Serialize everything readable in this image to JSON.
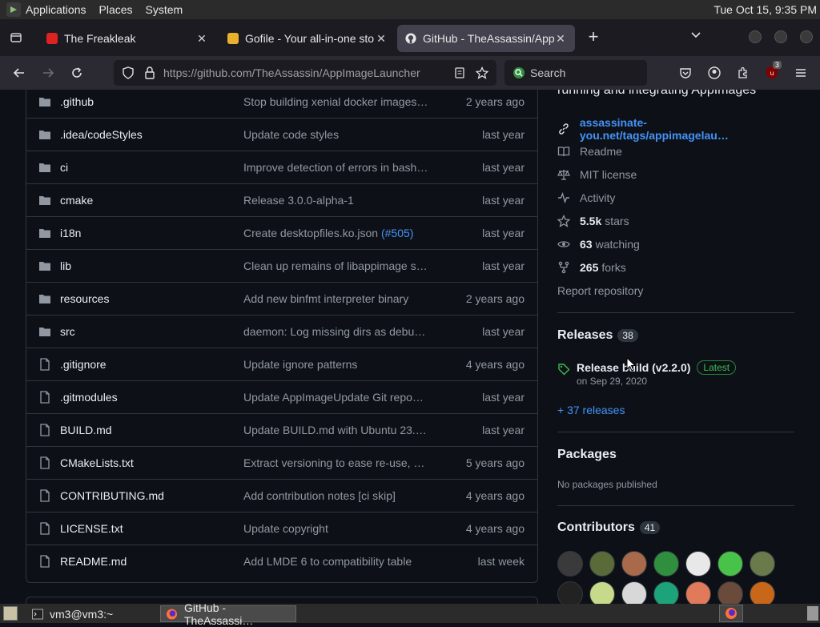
{
  "top_panel": {
    "menus": [
      "Applications",
      "Places",
      "System"
    ],
    "clock": "Tue Oct 15,  9:35 PM"
  },
  "tabs": [
    {
      "title": "The Freakleak",
      "close": "✕"
    },
    {
      "title": "Gofile - Your all-in-one storage",
      "close": "✕"
    },
    {
      "title": "GitHub - TheAssassin/AppImageLauncher",
      "close": "✕"
    }
  ],
  "toolbar": {
    "new_tab": "+",
    "url_host": "https://github.com",
    "url_path": "/TheAssassin/AppImageLauncher",
    "search_placeholder": "Search",
    "extension_badge": "3"
  },
  "files": [
    {
      "name": ".github",
      "type": "folder",
      "message": "Stop building xenial docker images…",
      "date": "2 years ago"
    },
    {
      "name": ".idea/codeStyles",
      "type": "folder",
      "message": "Update code styles",
      "date": "last year"
    },
    {
      "name": "ci",
      "type": "folder",
      "message": "Improve detection of errors in bash…",
      "date": "last year"
    },
    {
      "name": "cmake",
      "type": "folder",
      "message": "Release 3.0.0-alpha-1",
      "date": "last year"
    },
    {
      "name": "i18n",
      "type": "folder",
      "message": "Create desktopfiles.ko.json ",
      "link": "(#505)",
      "date": "last year"
    },
    {
      "name": "lib",
      "type": "folder",
      "message": "Clean up remains of libappimage s…",
      "date": "last year"
    },
    {
      "name": "resources",
      "type": "folder",
      "message": "Add new binfmt interpreter binary",
      "date": "2 years ago"
    },
    {
      "name": "src",
      "type": "folder",
      "message": "daemon: Log missing dirs as debu…",
      "date": "last year"
    },
    {
      "name": ".gitignore",
      "type": "file",
      "message": "Update ignore patterns",
      "date": "4 years ago"
    },
    {
      "name": ".gitmodules",
      "type": "file",
      "message": "Update AppImageUpdate Git repo…",
      "date": "last year"
    },
    {
      "name": "BUILD.md",
      "type": "file",
      "message": "Update BUILD.md with Ubuntu 23.…",
      "date": "last year"
    },
    {
      "name": "CMakeLists.txt",
      "type": "file",
      "message": "Extract versioning to ease re-use, …",
      "date": "5 years ago"
    },
    {
      "name": "CONTRIBUTING.md",
      "type": "file",
      "message": "Add contribution notes [ci skip]",
      "date": "4 years ago"
    },
    {
      "name": "LICENSE.txt",
      "type": "file",
      "message": "Update copyright",
      "date": "4 years ago"
    },
    {
      "name": "README.md",
      "type": "file",
      "message": "Add LMDE 6 to compatibility table",
      "date": "last week"
    }
  ],
  "sidebar": {
    "about_tail": "running and integrating AppImages",
    "website": "assassinate-you.net/tags/appimagelau…",
    "readme": "Readme",
    "license": "MIT license",
    "activity": "Activity",
    "stars_count": "5.5k",
    "stars_label": "stars",
    "watching_count": "63",
    "watching_label": "watching",
    "forks_count": "265",
    "forks_label": "forks",
    "report": "Report repository",
    "releases_heading": "Releases",
    "releases_count": "38",
    "release_title": "Release build (v2.2.0)",
    "release_badge": "Latest",
    "release_date": "on Sep 29, 2020",
    "more_releases": "+ 37 releases",
    "packages_heading": "Packages",
    "packages_none": "No packages published",
    "contributors_heading": "Contributors",
    "contributors_count": "41",
    "avatar_colors": [
      "#3a3a3a",
      "#5a6b3a",
      "#a86a4a",
      "#2f8f3f",
      "#e8e8e8",
      "#48c248",
      "#6b7a4a",
      "#222222",
      "#c7d98a",
      "#d8d8d8",
      "#1ca37a",
      "#e07a5a",
      "#6a4a3a",
      "#c8661a"
    ]
  },
  "taskbar": {
    "terminal": "vm3@vm3:~",
    "browser": "GitHub - TheAssassi…"
  },
  "colors": {
    "accent_link": "#4493f8",
    "latest_badge": "#3fb950",
    "page_bg": "#0d1117"
  }
}
